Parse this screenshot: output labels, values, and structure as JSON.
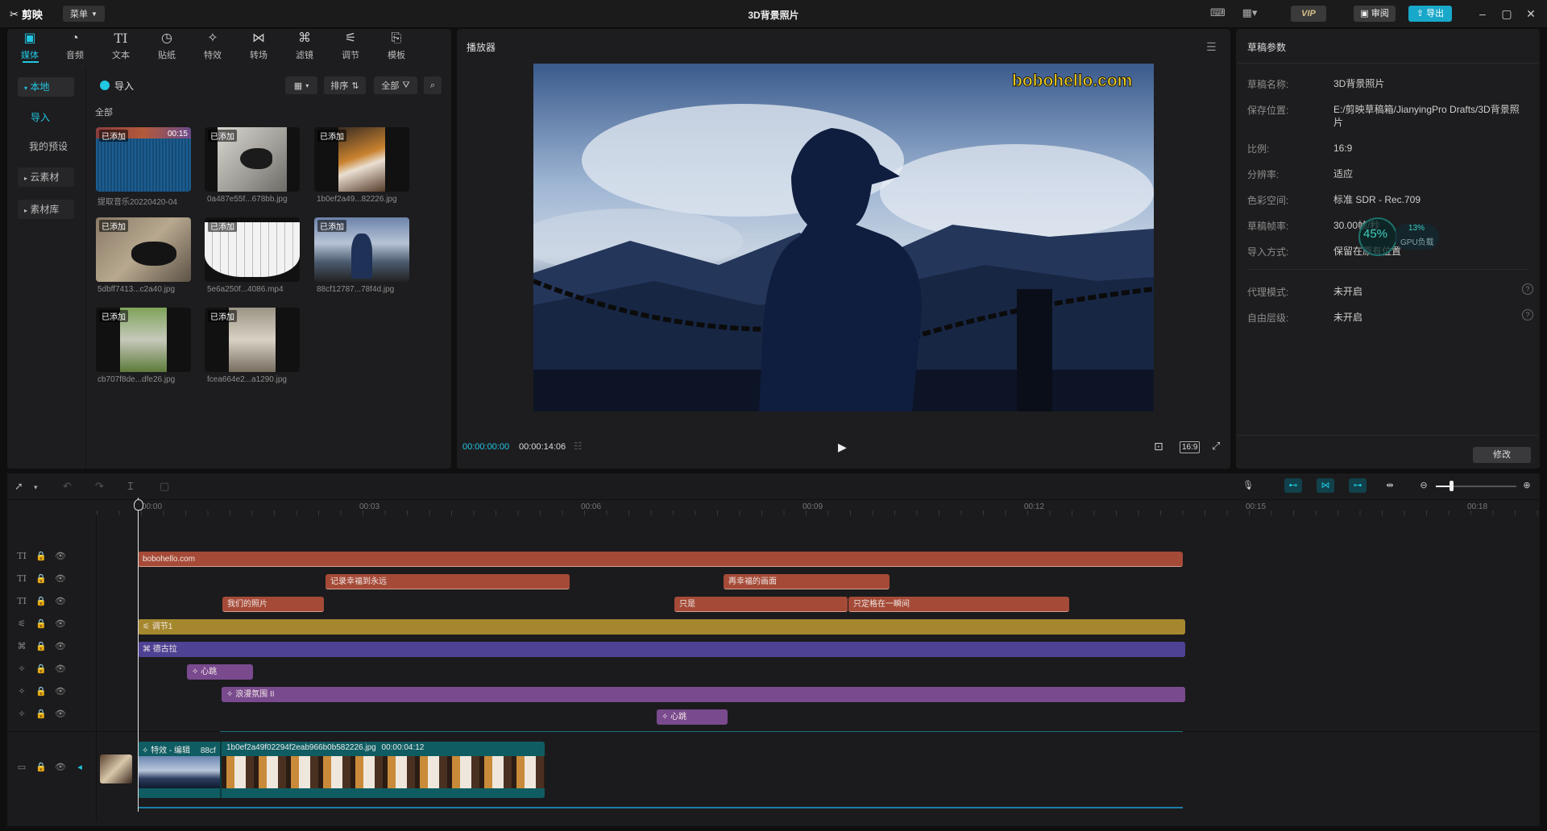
{
  "app": {
    "logo": "剪映",
    "menu_label": "菜单",
    "title": "3D背景照片",
    "review_label": "审阅",
    "export_label": "导出",
    "vip_label": "VIP"
  },
  "toolbar": {
    "tabs": [
      {
        "label": "媒体",
        "icon": "media-icon"
      },
      {
        "label": "音频",
        "icon": "audio-icon"
      },
      {
        "label": "文本",
        "icon": "text-icon"
      },
      {
        "label": "贴纸",
        "icon": "sticker-icon"
      },
      {
        "label": "特效",
        "icon": "effects-icon"
      },
      {
        "label": "转场",
        "icon": "transition-icon"
      },
      {
        "label": "滤镜",
        "icon": "filter-icon"
      },
      {
        "label": "调节",
        "icon": "adjust-icon"
      },
      {
        "label": "模板",
        "icon": "template-icon"
      }
    ]
  },
  "media": {
    "nav": {
      "local": "本地",
      "import": "导入",
      "presets": "我的预设",
      "cloud": "云素材",
      "library": "素材库"
    },
    "import_label": "导入",
    "sort_label": "排序",
    "filter_label": "全部",
    "all_label": "全部",
    "added_badge": "已添加",
    "items": [
      {
        "name": "提取音乐20220420-04",
        "duration": "00:15"
      },
      {
        "name": "0a487e55f...678bb.jpg"
      },
      {
        "name": "1b0ef2a49...82226.jpg"
      },
      {
        "name": "5dbff7413...c2a40.jpg"
      },
      {
        "name": "5e6a250f...4086.mp4"
      },
      {
        "name": "88cf12787...78f4d.jpg"
      },
      {
        "name": "cb707f8de...dfe26.jpg"
      },
      {
        "name": "fcea664e2...a1290.jpg"
      }
    ]
  },
  "player": {
    "title": "播放器",
    "watermark": "bobohello.com",
    "current_time": "00:00:00:00",
    "total_time": "00:00:14:06",
    "ratio": "16:9"
  },
  "props": {
    "title": "草稿参数",
    "rows": [
      {
        "label": "草稿名称:",
        "value": "3D背景照片"
      },
      {
        "label": "保存位置:",
        "value": "E:/剪映草稿箱/JianyingPro Drafts/3D背景照片"
      },
      {
        "label": "比例:",
        "value": "16:9"
      },
      {
        "label": "分辨率:",
        "value": "适应"
      },
      {
        "label": "色彩空间:",
        "value": "标准 SDR - Rec.709"
      },
      {
        "label": "草稿帧率:",
        "value": "30.00帧/秒"
      },
      {
        "label": "导入方式:",
        "value": "保留在原有位置"
      }
    ],
    "rows2": [
      {
        "label": "代理模式:",
        "value": "未开启"
      },
      {
        "label": "自由层级:",
        "value": "未开启"
      }
    ],
    "modify_label": "修改",
    "gpu": {
      "percent": "45%",
      "load_percent": "13%",
      "load_label": "GPU负载"
    }
  },
  "timeline": {
    "ticks": [
      "00:00",
      "00:03",
      "00:06",
      "00:09",
      "00:12",
      "00:15",
      "00:18"
    ],
    "clips": {
      "watermark_text": "bobohello.com",
      "text1": "记录幸福到永远",
      "text2": "再幸福的画面",
      "text3": "我们的照片",
      "text4": "只是",
      "text5": "只定格在一瞬间",
      "adjust": "调节1",
      "filter": "德古拉",
      "effect1": "心跳",
      "effect2": "浪漫氛围 II",
      "effect3": "心跳"
    },
    "main_track": {
      "label1": "特效 - 编辑",
      "label1b": "88cf",
      "label2": "1b0ef2a49f02294f2eab966b0b582226.jpg",
      "label2_duration": "00:00:04:12"
    }
  },
  "colors": {
    "accent": "#21c7e3",
    "text_clip": "#a54a37",
    "adjust_clip": "#a5882e",
    "filter_clip": "#4e4294",
    "effect_clip": "#7a4a8e",
    "main_track": "#0f5d62"
  }
}
